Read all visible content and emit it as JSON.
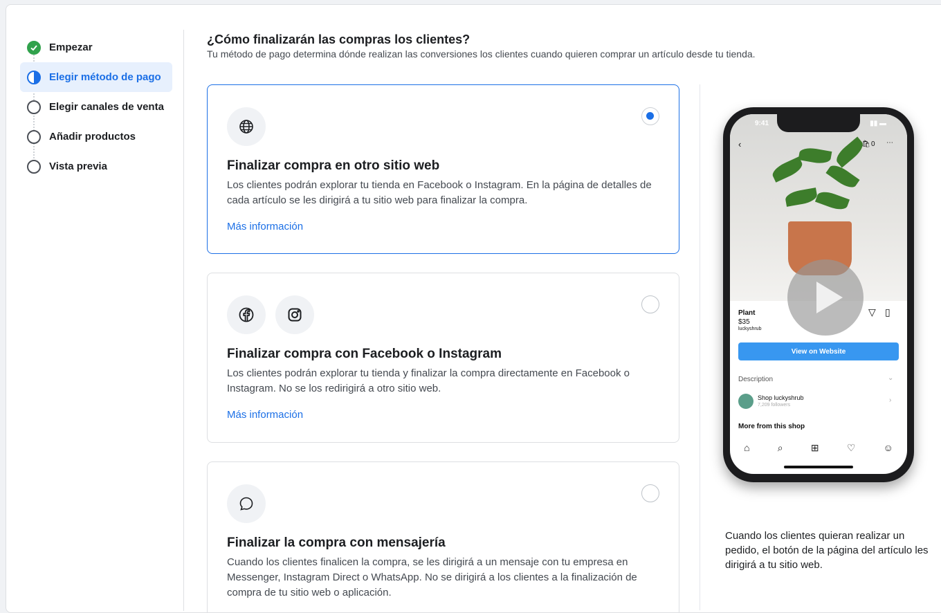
{
  "steps": [
    {
      "label": "Empezar",
      "state": "done"
    },
    {
      "label": "Elegir método de pago",
      "state": "active"
    },
    {
      "label": "Elegir canales de venta",
      "state": "todo"
    },
    {
      "label": "Añadir productos",
      "state": "todo"
    },
    {
      "label": "Vista previa",
      "state": "todo"
    }
  ],
  "header": {
    "title": "¿Cómo finalizarán las compras los clientes?",
    "subtitle": "Tu método de pago determina dónde realizan las conversiones los clientes cuando quieren comprar un artículo desde tu tienda."
  },
  "options": [
    {
      "title": "Finalizar compra en otro sitio web",
      "description": "Los clientes podrán explorar tu tienda en Facebook o Instagram. En la página de detalles de cada artículo se les dirigirá a tu sitio web para finalizar la compra.",
      "link": "Más información",
      "icons": [
        "globe-icon"
      ],
      "selected": true
    },
    {
      "title": "Finalizar compra con Facebook o Instagram",
      "description": "Los clientes podrán explorar tu tienda y finalizar la compra directamente en Facebook o Instagram. No se los redirigirá a otro sitio web.",
      "link": "Más información",
      "icons": [
        "facebook-icon",
        "instagram-icon"
      ],
      "selected": false
    },
    {
      "title": "Finalizar la compra con mensajería",
      "description": "Cuando los clientes finalicen la compra, se les dirigirá a un mensaje con tu empresa en Messenger, Instagram Direct o WhatsApp. No se dirigirá a los clientes a la finalización de compra de tu sitio web o aplicación.",
      "icons": [
        "chat-bubble-icon"
      ],
      "selected": false
    }
  ],
  "preview": {
    "time": "9:41",
    "cart_count": "0",
    "product_name": "Plant",
    "price": "$35",
    "shop_handle": "luckyshrub",
    "button": "View on Website",
    "description_label": "Description",
    "shop_name": "Shop luckyshrub",
    "followers": "7,209 followers",
    "more_label": "More from this shop",
    "caption": "Cuando los clientes quieran realizar un pedido, el botón de la página del artículo les dirigirá a tu sitio web."
  },
  "colors": {
    "accent": "#1b6fe6",
    "done": "#31a24c",
    "ig_button": "#3897f0"
  }
}
